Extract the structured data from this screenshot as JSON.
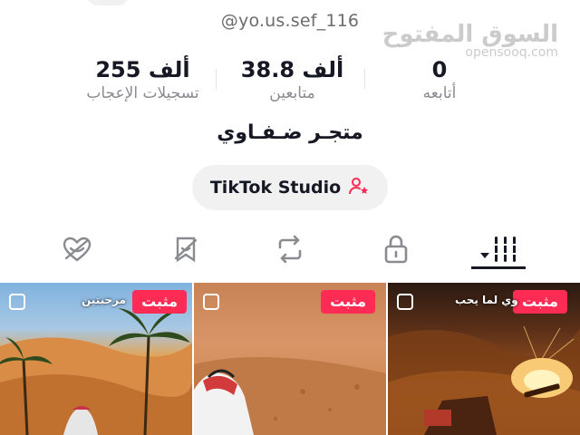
{
  "profile": {
    "handle": "@yo.us.sef_116",
    "bio": "متجـر ضـفـاوي"
  },
  "watermark": {
    "arabic": "السوق المفتوح",
    "latin": "opensooq.com"
  },
  "stats": {
    "likes": {
      "value": "255 ألف",
      "label": "تسجيلات الإعجاب"
    },
    "followers": {
      "value": "38.8 ألف",
      "label": "متابعين"
    },
    "following": {
      "value": "0",
      "label": "أتابعه"
    }
  },
  "studio_button": {
    "label": "TikTok Studio",
    "icon": "user-star-icon"
  },
  "tabs": [
    {
      "name": "liked",
      "icon": "heart-hidden-icon"
    },
    {
      "name": "favorites",
      "icon": "bookmark-hidden-icon"
    },
    {
      "name": "reposts",
      "icon": "repost-icon"
    },
    {
      "name": "private",
      "icon": "lock-icon"
    },
    {
      "name": "videos",
      "icon": "grid-icon",
      "selected": true
    }
  ],
  "videos": [
    {
      "badge": "مثبت",
      "caption": "مرحبتين"
    },
    {
      "badge": "مثبت",
      "caption": ""
    },
    {
      "badge": "مثبت",
      "caption": "وي لما يحب"
    }
  ],
  "colors": {
    "accent": "#fe2c55",
    "text": "#161823",
    "muted": "#8a8b91",
    "button_bg": "#f1f1f2"
  }
}
